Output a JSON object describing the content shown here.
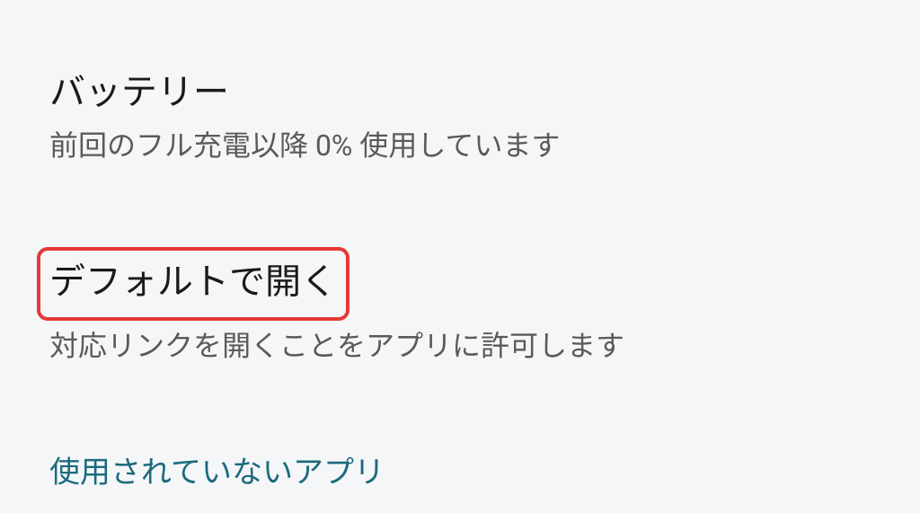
{
  "settings": {
    "battery": {
      "title": "バッテリー",
      "subtitle": "前回のフル充電以降 0% 使用しています"
    },
    "open_default": {
      "title": "デフォルトで開く",
      "subtitle": "対応リンクを開くことをアプリに許可します"
    },
    "unused_apps": {
      "title": "使用されていないアプリ"
    }
  },
  "annotation": {
    "highlight_color": "#e53935"
  }
}
